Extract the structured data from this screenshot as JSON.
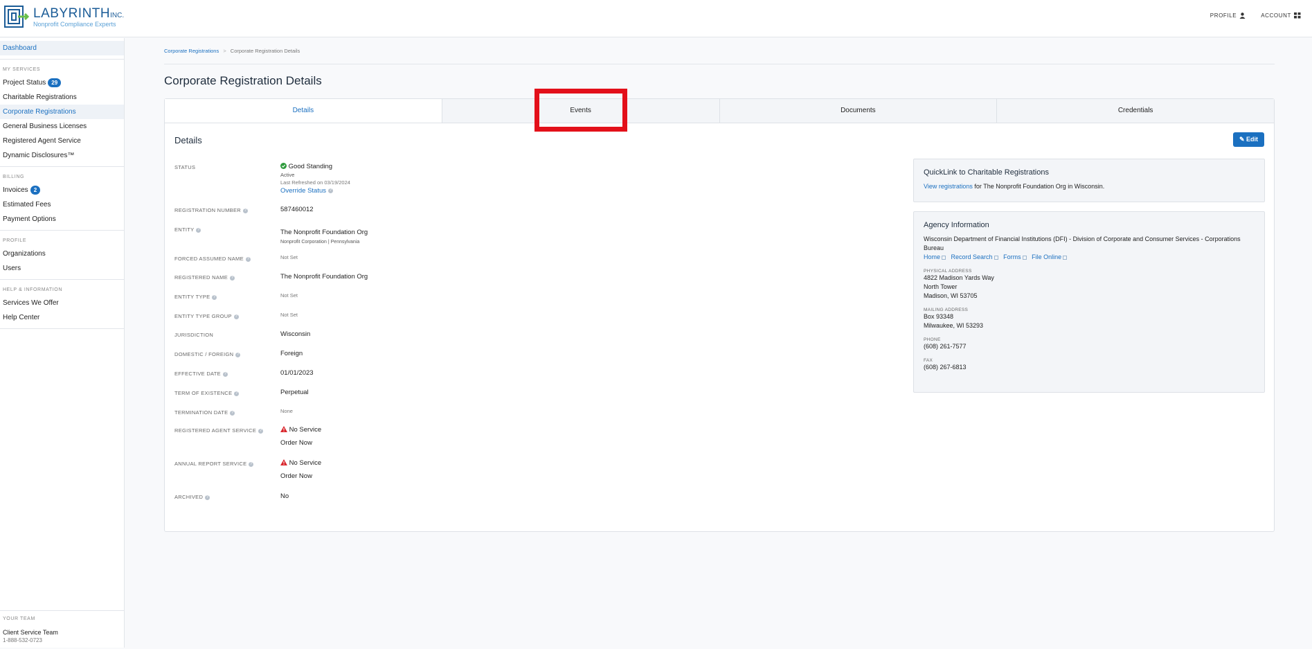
{
  "brand": {
    "name": "LABYRINTH",
    "inc": "INC.",
    "tagline": "Nonprofit Compliance Experts"
  },
  "topnav": {
    "profile": "PROFILE",
    "account": "ACCOUNT"
  },
  "sidebar": {
    "dashboard": "Dashboard",
    "my_services_title": "MY SERVICES",
    "project_status": "Project Status",
    "project_status_count": "29",
    "charitable_registrations": "Charitable Registrations",
    "corporate_registrations": "Corporate Registrations",
    "general_business_licenses": "General Business Licenses",
    "registered_agent_service": "Registered Agent Service",
    "dynamic_disclosures": "Dynamic Disclosures™",
    "billing_title": "BILLING",
    "invoices": "Invoices",
    "invoices_count": "2",
    "estimated_fees": "Estimated Fees",
    "payment_options": "Payment Options",
    "profile_title": "PROFILE",
    "organizations": "Organizations",
    "users": "Users",
    "help_title": "HELP & INFORMATION",
    "services_we_offer": "Services We Offer",
    "help_center": "Help Center",
    "team_title": "YOUR TEAM",
    "team_name": "Client Service Team",
    "team_phone": "1-888-532-0723"
  },
  "breadcrumb": {
    "parent": "Corporate Registrations",
    "separator": ">",
    "current": "Corporate Registration Details"
  },
  "page_title": "Corporate Registration Details",
  "tabs": [
    "Details",
    "Events",
    "Documents",
    "Credentials"
  ],
  "details": {
    "title": "Details",
    "edit_label": "Edit",
    "status_label": "STATUS",
    "status_value": "Good Standing",
    "status_sub": "Active",
    "status_refreshed": "Last Refreshed on 03/19/2024",
    "override_status": "Override Status",
    "registration_number_label": "REGISTRATION NUMBER",
    "registration_number": "587460012",
    "entity_label": "ENTITY",
    "entity_value": "The Nonprofit Foundation Org",
    "entity_sub": "Nonprofit Corporation | Pennsylvania",
    "forced_assumed_name_label": "FORCED ASSUMED NAME",
    "forced_assumed_name": "Not Set",
    "registered_name_label": "REGISTERED NAME",
    "registered_name": "The Nonprofit Foundation Org",
    "entity_type_label": "ENTITY TYPE",
    "entity_type": "Not Set",
    "entity_type_group_label": "ENTITY TYPE GROUP",
    "entity_type_group": "Not Set",
    "jurisdiction_label": "JURISDICTION",
    "jurisdiction": "Wisconsin",
    "domestic_foreign_label": "DOMESTIC / FOREIGN",
    "domestic_foreign": "Foreign",
    "effective_date_label": "EFFECTIVE DATE",
    "effective_date": "01/01/2023",
    "term_of_existence_label": "TERM OF EXISTENCE",
    "term_of_existence": "Perpetual",
    "termination_date_label": "TERMINATION DATE",
    "termination_date": "None",
    "registered_agent_service_label": "REGISTERED AGENT SERVICE",
    "registered_agent_service": "No Service",
    "order_now": "Order Now",
    "annual_report_service_label": "ANNUAL REPORT SERVICE",
    "annual_report_service": "No Service",
    "archived_label": "ARCHIVED",
    "archived": "No"
  },
  "quicklink": {
    "title": "QuickLink to Charitable Registrations",
    "link": "View registrations",
    "text": " for The Nonprofit Foundation Org in Wisconsin."
  },
  "agency": {
    "title": "Agency Information",
    "name": "Wisconsin Department of Financial Institutions (DFI) - Division of Corporate and Consumer Services - Corporations Bureau",
    "links": [
      "Home",
      "Record Search",
      "Forms",
      "File Online"
    ],
    "physical_label": "PHYSICAL ADDRESS",
    "physical": [
      "4822 Madison Yards Way",
      "North Tower",
      "Madison, WI 53705"
    ],
    "mailing_label": "MAILING ADDRESS",
    "mailing": [
      "Box 93348",
      "Milwaukee, WI 53293"
    ],
    "phone_label": "PHONE",
    "phone": "(608) 261-7577",
    "fax_label": "FAX",
    "fax": "(608) 267-6813"
  },
  "colors": {
    "accent": "#1b70c0",
    "highlight": "#e3101a",
    "success": "#2e9b3c",
    "warning": "#d9262c"
  }
}
